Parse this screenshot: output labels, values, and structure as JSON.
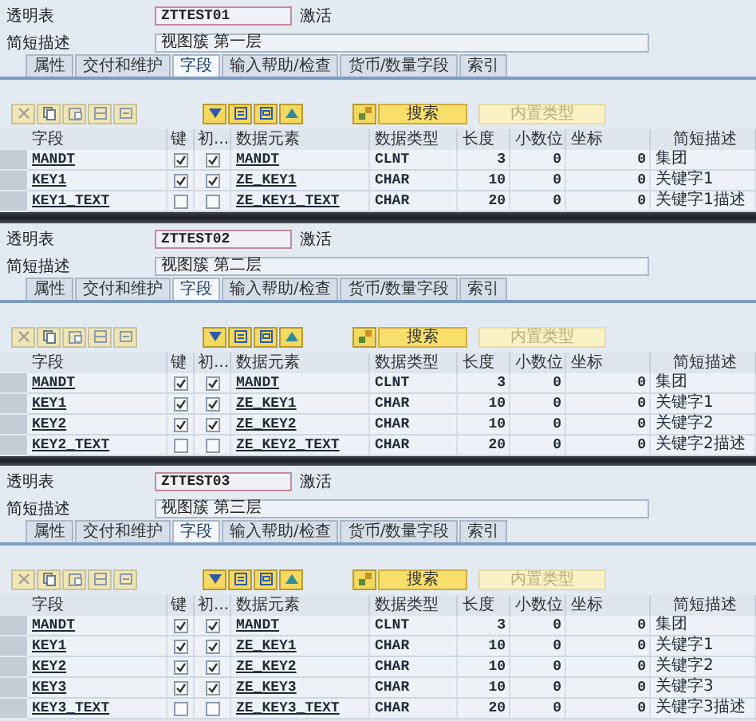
{
  "panels": [
    {
      "table_label": "透明表",
      "table_name": "ZTTEST01",
      "status": "激活",
      "desc_label": "简短描述",
      "description": "视图簇 第一层",
      "tabs": [
        {
          "label": "属性",
          "selected": false
        },
        {
          "label": "交付和维护",
          "selected": false
        },
        {
          "label": "字段",
          "selected": true
        },
        {
          "label": "输入帮助/检查",
          "selected": false
        },
        {
          "label": "货币/数量字段",
          "selected": false
        },
        {
          "label": "索引",
          "selected": false
        }
      ],
      "search_button": {
        "label": "搜索",
        "disabled": false
      },
      "builtin_type_button": {
        "label": "内置类型",
        "disabled": true
      },
      "columns": [
        "字段",
        "键",
        "初...",
        "数据元素",
        "数据类型",
        "长度",
        "小数位",
        "坐标",
        "简短描述"
      ],
      "rows": [
        {
          "field": "MANDT",
          "key": true,
          "initial": true,
          "data_element": "MANDT",
          "data_type": "CLNT",
          "length": "3",
          "decimals": "0",
          "coordinate": "0",
          "short_desc": "集团"
        },
        {
          "field": "KEY1",
          "key": true,
          "initial": true,
          "data_element": "ZE_KEY1",
          "data_type": "CHAR",
          "length": "10",
          "decimals": "0",
          "coordinate": "0",
          "short_desc": "关键字1"
        },
        {
          "field": "KEY1_TEXT",
          "key": false,
          "initial": false,
          "data_element": "ZE_KEY1_TEXT",
          "data_type": "CHAR",
          "length": "20",
          "decimals": "0",
          "coordinate": "0",
          "short_desc": "关键字1描述"
        }
      ]
    },
    {
      "table_label": "透明表",
      "table_name": "ZTTEST02",
      "status": "激活",
      "desc_label": "简短描述",
      "description": "视图簇 第二层",
      "tabs": [
        {
          "label": "属性",
          "selected": false
        },
        {
          "label": "交付和维护",
          "selected": false
        },
        {
          "label": "字段",
          "selected": true
        },
        {
          "label": "输入帮助/检查",
          "selected": false
        },
        {
          "label": "货币/数量字段",
          "selected": false
        },
        {
          "label": "索引",
          "selected": false
        }
      ],
      "search_button": {
        "label": "搜索",
        "disabled": false
      },
      "builtin_type_button": {
        "label": "内置类型",
        "disabled": true
      },
      "columns": [
        "字段",
        "键",
        "初...",
        "数据元素",
        "数据类型",
        "长度",
        "小数位",
        "坐标",
        "简短描述"
      ],
      "rows": [
        {
          "field": "MANDT",
          "key": true,
          "initial": true,
          "data_element": "MANDT",
          "data_type": "CLNT",
          "length": "3",
          "decimals": "0",
          "coordinate": "0",
          "short_desc": "集团"
        },
        {
          "field": "KEY1",
          "key": true,
          "initial": true,
          "data_element": "ZE_KEY1",
          "data_type": "CHAR",
          "length": "10",
          "decimals": "0",
          "coordinate": "0",
          "short_desc": "关键字1"
        },
        {
          "field": "KEY2",
          "key": true,
          "initial": true,
          "data_element": "ZE_KEY2",
          "data_type": "CHAR",
          "length": "10",
          "decimals": "0",
          "coordinate": "0",
          "short_desc": "关键字2"
        },
        {
          "field": "KEY2_TEXT",
          "key": false,
          "initial": false,
          "data_element": "ZE_KEY2_TEXT",
          "data_type": "CHAR",
          "length": "20",
          "decimals": "0",
          "coordinate": "0",
          "short_desc": "关键字2描述"
        }
      ]
    },
    {
      "table_label": "透明表",
      "table_name": "ZTTEST03",
      "status": "激活",
      "desc_label": "简短描述",
      "description": "视图簇 第三层",
      "tabs": [
        {
          "label": "属性",
          "selected": false
        },
        {
          "label": "交付和维护",
          "selected": false
        },
        {
          "label": "字段",
          "selected": true
        },
        {
          "label": "输入帮助/检查",
          "selected": false
        },
        {
          "label": "货币/数量字段",
          "selected": false
        },
        {
          "label": "索引",
          "selected": false
        }
      ],
      "search_button": {
        "label": "搜索",
        "disabled": false
      },
      "builtin_type_button": {
        "label": "内置类型",
        "disabled": true
      },
      "columns": [
        "字段",
        "键",
        "初...",
        "数据元素",
        "数据类型",
        "长度",
        "小数位",
        "坐标",
        "简短描述"
      ],
      "rows": [
        {
          "field": "MANDT",
          "key": true,
          "initial": true,
          "data_element": "MANDT",
          "data_type": "CLNT",
          "length": "3",
          "decimals": "0",
          "coordinate": "0",
          "short_desc": "集团"
        },
        {
          "field": "KEY1",
          "key": true,
          "initial": true,
          "data_element": "ZE_KEY1",
          "data_type": "CHAR",
          "length": "10",
          "decimals": "0",
          "coordinate": "0",
          "short_desc": "关键字1"
        },
        {
          "field": "KEY2",
          "key": true,
          "initial": true,
          "data_element": "ZE_KEY2",
          "data_type": "CHAR",
          "length": "10",
          "decimals": "0",
          "coordinate": "0",
          "short_desc": "关键字2"
        },
        {
          "field": "KEY3",
          "key": true,
          "initial": true,
          "data_element": "ZE_KEY3",
          "data_type": "CHAR",
          "length": "10",
          "decimals": "0",
          "coordinate": "0",
          "short_desc": "关键字3"
        },
        {
          "field": "KEY3_TEXT",
          "key": false,
          "initial": false,
          "data_element": "ZE_KEY3_TEXT",
          "data_type": "CHAR",
          "length": "20",
          "decimals": "0",
          "coordinate": "0",
          "short_desc": "关键字3描述"
        }
      ]
    }
  ]
}
